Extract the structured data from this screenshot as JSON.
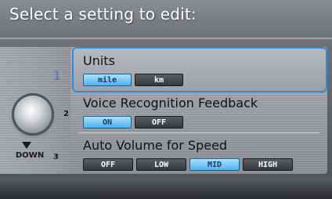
{
  "screen": {
    "title": "Select a setting to edit:"
  },
  "knob": {
    "index_1": "1",
    "index_2": "2",
    "index_3": "3",
    "down_label": "DOWN"
  },
  "settings": [
    {
      "label": "Units",
      "options": [
        "mile",
        "km"
      ],
      "selected": "mile",
      "highlighted": true
    },
    {
      "label": "Voice Recognition Feedback",
      "options": [
        "ON",
        "OFF"
      ],
      "selected": "ON",
      "highlighted": false
    },
    {
      "label": "Auto Volume for Speed",
      "options": [
        "OFF",
        "LOW",
        "MID",
        "HIGH"
      ],
      "selected": "MID",
      "highlighted": false
    }
  ],
  "colors": {
    "highlight_border": "#2a8fe0",
    "selected_button": "#4fb1ee",
    "unselected_button": "#35383c"
  }
}
